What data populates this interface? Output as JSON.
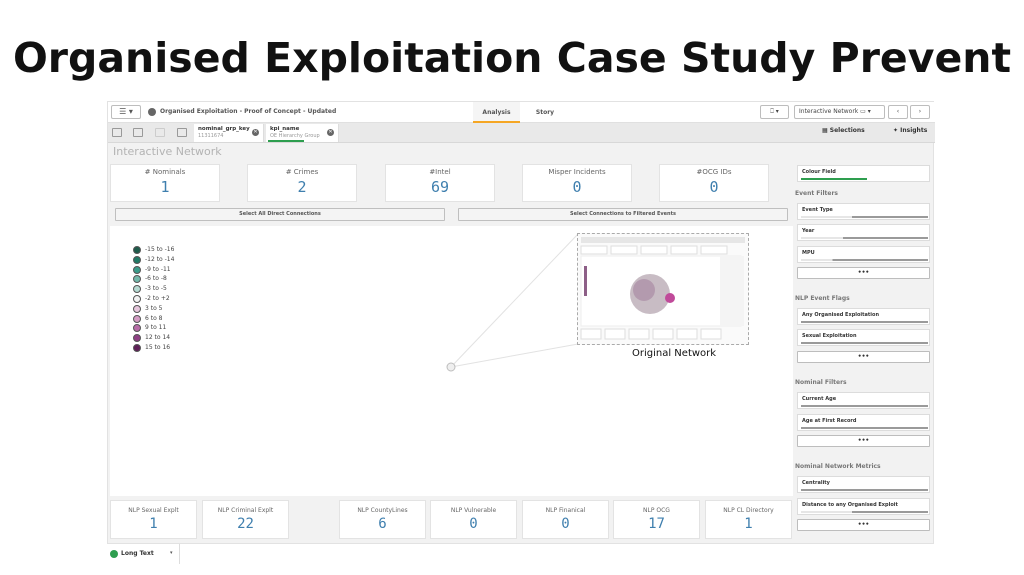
{
  "slide": {
    "title": "Organised Exploitation Case Study Prevent"
  },
  "toolbar": {
    "menu_label": "☰ ▾",
    "app_title": "Organised Exploitation - Proof of Concept - Updated",
    "tabs": [
      {
        "label": "Analysis",
        "active": true
      },
      {
        "label": "Story",
        "active": false
      }
    ],
    "bookmark_label": "⎕ ▾",
    "sheet_selector_label": "Interactive Network ▭ ▾",
    "prev_label": "‹",
    "next_label": "›"
  },
  "selection_bar": {
    "chips": [
      {
        "title": "nominal_grp_key",
        "value": "11311674"
      },
      {
        "title": "kpi_name",
        "value": "OE Hierarchy Group"
      }
    ],
    "selections_label": "Selections",
    "insights_label": "Insights"
  },
  "sheet": {
    "title": "Interactive Network",
    "kpis_top": [
      {
        "label": "# Nominals",
        "value": "1"
      },
      {
        "label": "# Crimes",
        "value": "2"
      },
      {
        "label": "#Intel",
        "value": "69"
      },
      {
        "label": "Misper Incidents",
        "value": "0"
      },
      {
        "label": "#OCG IDs",
        "value": "0"
      }
    ],
    "buttons": [
      "Select All Direct Connections",
      "Select Connections to Filtered Events"
    ],
    "legend": [
      {
        "label": "-15 to -16",
        "color": "#1f5b4b"
      },
      {
        "label": "-12 to -14",
        "color": "#217a66"
      },
      {
        "label": "-9 to -11",
        "color": "#3a9c8a"
      },
      {
        "label": "-6 to -8",
        "color": "#73b9ab"
      },
      {
        "label": "-3 to -5",
        "color": "#b6dad2"
      },
      {
        "label": "-2 to +2",
        "color": "#f3f3f3"
      },
      {
        "label": "3 to 5",
        "color": "#e6c6dc"
      },
      {
        "label": "6 to 8",
        "color": "#d49cc4"
      },
      {
        "label": "9 to 11",
        "color": "#b76ca7"
      },
      {
        "label": "12 to 14",
        "color": "#8e3f83"
      },
      {
        "label": "15 to 16",
        "color": "#5e1f57"
      }
    ],
    "thumbnail_caption": "Original Network",
    "kpis_bottom": [
      {
        "label": "NLP Sexual Explt",
        "value": "1"
      },
      {
        "label": "NLP Criminal Explt",
        "value": "22"
      },
      {
        "label": "NLP CountyLines",
        "value": "6"
      },
      {
        "label": "NLP Vulnerable",
        "value": "0"
      },
      {
        "label": "NLP Finanical",
        "value": "0"
      },
      {
        "label": "NLP OCG",
        "value": "17"
      },
      {
        "label": "NLP CL Directory",
        "value": "1"
      }
    ]
  },
  "filters": {
    "colour_field": "Colour Field",
    "event_filters": {
      "heading": "Event Filters",
      "items": [
        "Event Type",
        "Year",
        "MPU"
      ]
    },
    "nlp_event_flags": {
      "heading": "NLP Event Flags",
      "items": [
        "Any Organised Exploitation",
        "Sexual Exploitation"
      ]
    },
    "nominal_filters": {
      "heading": "Nominal Filters",
      "items": [
        "Current Age",
        "Age at First Record"
      ]
    },
    "network_metrics": {
      "heading": "Nominal Network Metrics",
      "items": [
        "Centrality",
        "Distance to any Organised Exploit"
      ]
    },
    "more_label": "•••"
  },
  "status": {
    "label": "Long Text",
    "caret": "▾"
  },
  "colors": {
    "kpi_value": "#3f7fae",
    "accent_tab": "#f5a623",
    "selection_green": "#2e9e4f"
  }
}
